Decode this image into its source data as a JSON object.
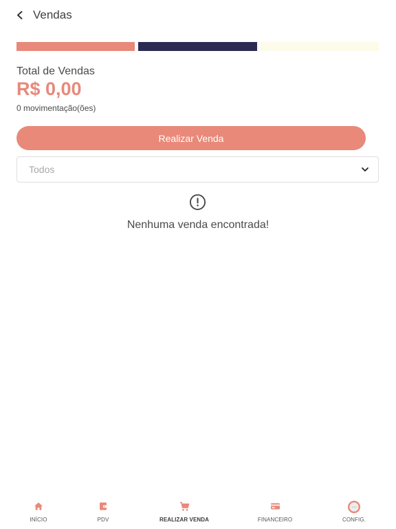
{
  "header": {
    "title": "Vendas",
    "back_icon": "chevron-left-icon"
  },
  "colors": {
    "accent": "#e8897a",
    "navy": "#2b2a52",
    "cream": "#fdfbe9"
  },
  "summary": {
    "total_label": "Total de Vendas",
    "total_value": "R$ 0,00",
    "movements": "0 movimentação(ões)"
  },
  "actions": {
    "sale_button_label": "Realizar Venda"
  },
  "filter": {
    "selected": "Todos"
  },
  "empty_state": {
    "icon": "alert-circle-icon",
    "message": "Nenhuma venda encontrada!"
  },
  "bottom_nav": {
    "items": [
      {
        "label": "INÍCIO",
        "icon": "home-icon",
        "active": false
      },
      {
        "label": "PDV",
        "icon": "wallet-icon",
        "active": false
      },
      {
        "label": "REALIZAR VENDA",
        "icon": "cart-icon",
        "active": true
      },
      {
        "label": "FINANCEIRO",
        "icon": "credit-card-icon",
        "active": false
      },
      {
        "label": "CONFIG.",
        "icon": "avatar-icon",
        "active": false
      }
    ]
  }
}
